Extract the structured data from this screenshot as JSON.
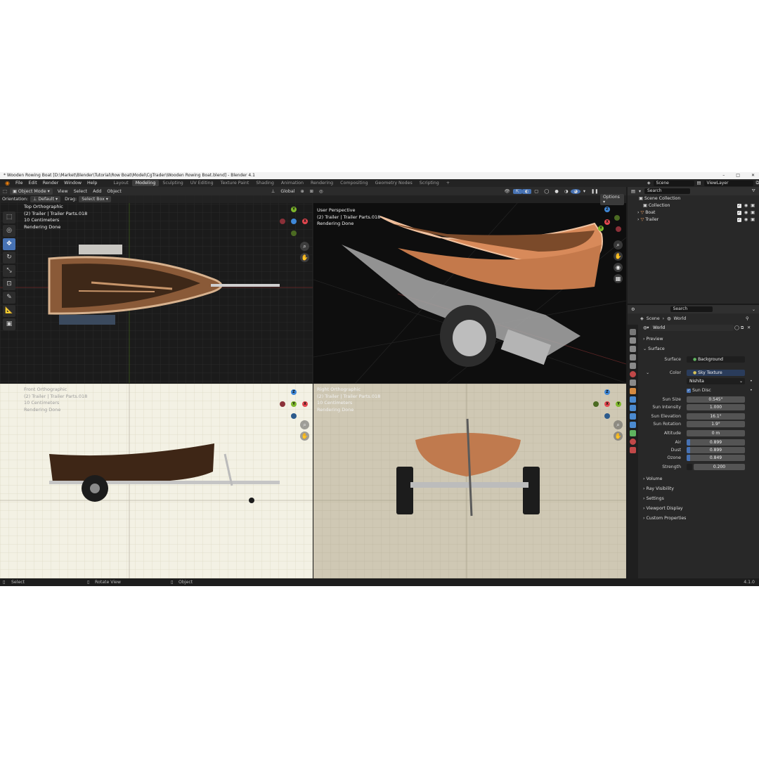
{
  "window": {
    "title": "* Wooden Rowing Boat [D:\\Market\\Blender\\Tutorial\\Row Boat\\Model\\CgTrader\\Wooden Rowing Boat.blend] - Blender 4.1",
    "minimize": "–",
    "maximize": "□",
    "close": "✕"
  },
  "menu": [
    "File",
    "Edit",
    "Render",
    "Window",
    "Help"
  ],
  "workspaces": [
    "Layout",
    "Modeling",
    "Sculpting",
    "UV Editing",
    "Texture Paint",
    "Shading",
    "Animation",
    "Rendering",
    "Compositing",
    "Geometry Nodes",
    "Scripting",
    "+"
  ],
  "active_workspace": "Modeling",
  "scene_field": "Scene",
  "viewlayer_field": "ViewLayer",
  "header": {
    "mode": "Object Mode",
    "view": "View",
    "select": "Select",
    "add": "Add",
    "object": "Object",
    "transform_orientation": "Global",
    "options": "Options"
  },
  "toolsettings": {
    "orientation_label": "Orientation:",
    "orientation_value": "Default",
    "drag_label": "Drag:",
    "drag_value": "Select Box"
  },
  "viewports": {
    "top": {
      "line1": "Top Orthographic",
      "line2": "(2) Trailer | Trailer Parts.018",
      "line3": "10 Centimeters",
      "line4": "Rendering Done"
    },
    "persp": {
      "line1": "User Perspective",
      "line2": "(2) Trailer | Trailer Parts.018",
      "line3": "Rendering Done"
    },
    "front": {
      "line1": "Front Orthographic",
      "line2": "(2) Trailer | Trailer Parts.018",
      "line3": "10 Centimeters",
      "line4": "Rendering Done"
    },
    "right": {
      "line1": "Right Orthographic",
      "line2": "(2) Trailer | Trailer Parts.018",
      "line3": "10 Centimeters",
      "line4": "Rendering Done"
    }
  },
  "gizmo_axes": {
    "x": "X",
    "y": "Y",
    "z": "Z"
  },
  "outliner": {
    "search_placeholder": "Search",
    "items": [
      {
        "label": "Scene Collection"
      },
      {
        "label": "Collection"
      },
      {
        "label": "Boat"
      },
      {
        "label": "Trailer"
      }
    ]
  },
  "properties": {
    "search_placeholder": "Search",
    "breadcrumb_scene": "Scene",
    "breadcrumb_world": "World",
    "world_name": "World",
    "preview": "Preview",
    "surface": "Surface",
    "surface_label": "Surface",
    "surface_value": "Background",
    "color_label": "Color",
    "color_value": "Sky Texture",
    "sky_type": "Nishita",
    "sun_disc": "Sun Disc",
    "sun_size_label": "Sun Size",
    "sun_size": "0.545°",
    "sun_intensity_label": "Sun Intensity",
    "sun_intensity": "1.000",
    "sun_elevation_label": "Sun Elevation",
    "sun_elevation": "16.1°",
    "sun_rotation_label": "Sun Rotation",
    "sun_rotation": "1.9°",
    "altitude_label": "Altitude",
    "altitude": "0 m",
    "air_label": "Air",
    "air": "0.899",
    "dust_label": "Dust",
    "dust": "0.899",
    "ozone_label": "Ozone",
    "ozone": "0.849",
    "strength_label": "Strength",
    "strength": "0.200",
    "volume": "Volume",
    "ray_visibility": "Ray Visibility",
    "settings": "Settings",
    "viewport_display": "Viewport Display",
    "custom_properties": "Custom Properties"
  },
  "statusbar": {
    "select": "Select",
    "rotate": "Rotate View",
    "object": "Object",
    "version": "4.1.0"
  },
  "colors": {
    "accent": "#4772b3",
    "axis_x": "#e4474f",
    "axis_y": "#7eb82c",
    "axis_z": "#3f88d8"
  }
}
